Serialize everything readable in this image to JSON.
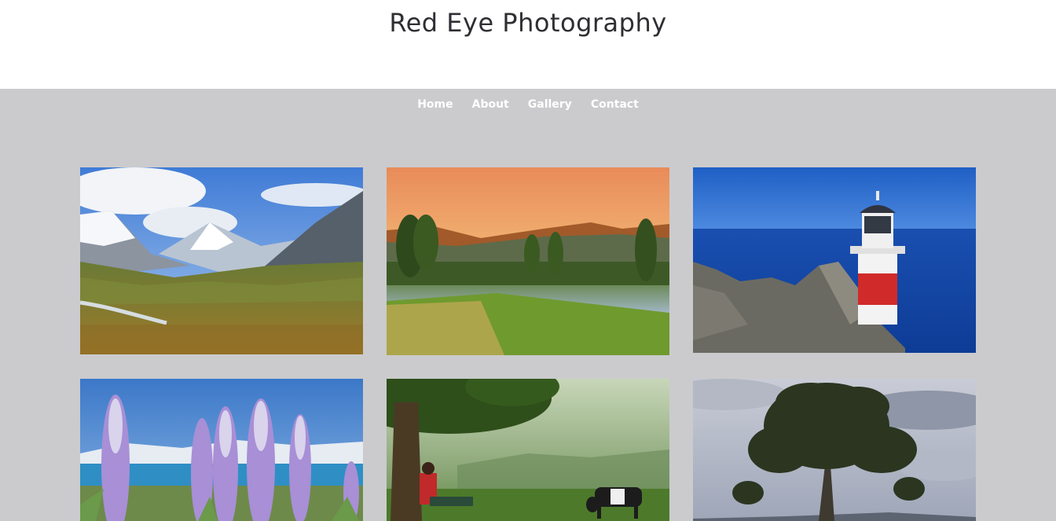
{
  "site": {
    "title": "Red Eye Photography"
  },
  "nav": {
    "items": [
      "Home",
      "About",
      "Gallery",
      "Contact"
    ]
  },
  "gallery": {
    "photos": [
      {
        "subject": "mountain-valley"
      },
      {
        "subject": "sunset-lake"
      },
      {
        "subject": "lighthouse"
      },
      {
        "subject": "lupine-flowers"
      },
      {
        "subject": "woman-under-tree-with-cow"
      },
      {
        "subject": "lone-tree"
      }
    ]
  },
  "colors": {
    "background": "#cbcbcd",
    "header": "#ffffff",
    "title": "#2e2e33",
    "nav_text": "#ffffff"
  }
}
